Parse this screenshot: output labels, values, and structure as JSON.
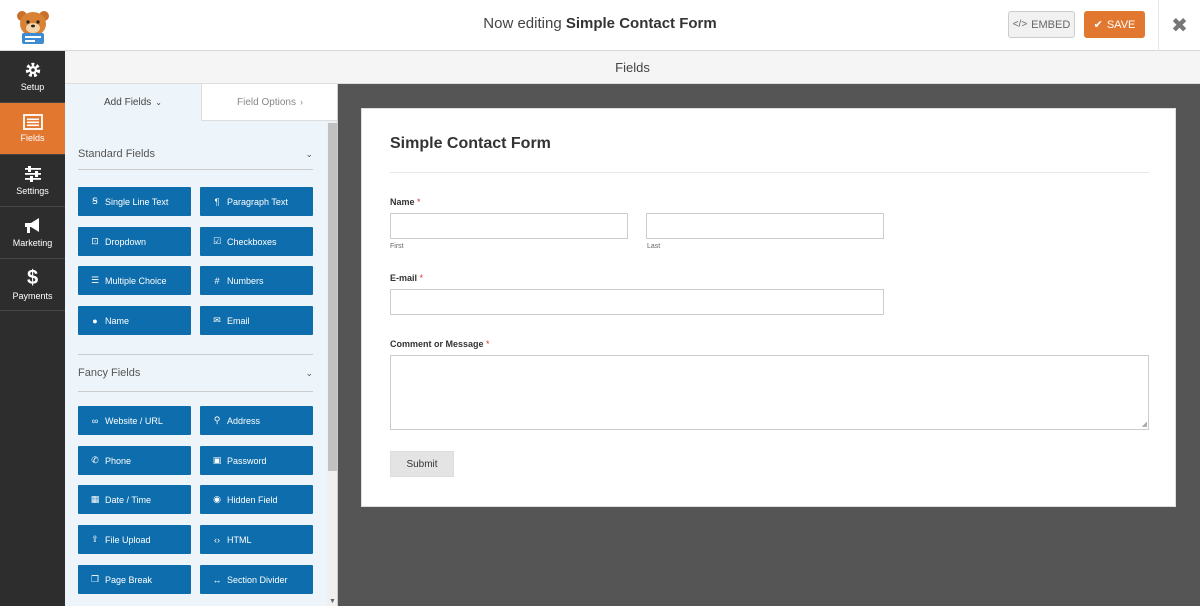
{
  "header": {
    "title_prefix": "Now editing",
    "title_form": "Simple Contact Form",
    "embed_label": "EMBED",
    "save_label": "SAVE",
    "accent": "#e27730"
  },
  "leftnav": {
    "items": [
      {
        "label": "Setup",
        "icon": "gear-icon"
      },
      {
        "label": "Fields",
        "icon": "fields-icon",
        "active": true
      },
      {
        "label": "Settings",
        "icon": "sliders-icon"
      },
      {
        "label": "Marketing",
        "icon": "megaphone-icon"
      },
      {
        "label": "Payments",
        "icon": "dollar-icon"
      }
    ]
  },
  "fieldsbar": {
    "title": "Fields"
  },
  "panel": {
    "tabs": {
      "add_fields": "Add Fields",
      "field_options": "Field Options"
    },
    "standard": {
      "title": "Standard Fields",
      "buttons": [
        {
          "label": "Single Line Text",
          "icon": "text-icon"
        },
        {
          "label": "Paragraph Text",
          "icon": "paragraph-icon"
        },
        {
          "label": "Dropdown",
          "icon": "dropdown-icon"
        },
        {
          "label": "Checkboxes",
          "icon": "checkbox-icon"
        },
        {
          "label": "Multiple Choice",
          "icon": "list-icon"
        },
        {
          "label": "Numbers",
          "icon": "hash-icon"
        },
        {
          "label": "Name",
          "icon": "user-icon"
        },
        {
          "label": "Email",
          "icon": "envelope-icon"
        }
      ]
    },
    "fancy": {
      "title": "Fancy Fields",
      "buttons": [
        {
          "label": "Website / URL",
          "icon": "link-icon"
        },
        {
          "label": "Address",
          "icon": "map-pin-icon"
        },
        {
          "label": "Phone",
          "icon": "phone-icon"
        },
        {
          "label": "Password",
          "icon": "lock-icon"
        },
        {
          "label": "Date / Time",
          "icon": "calendar-icon"
        },
        {
          "label": "Hidden Field",
          "icon": "eye-slash-icon"
        },
        {
          "label": "File Upload",
          "icon": "upload-icon"
        },
        {
          "label": "HTML",
          "icon": "code-icon"
        },
        {
          "label": "Page Break",
          "icon": "copy-icon"
        },
        {
          "label": "Section Divider",
          "icon": "arrows-h-icon"
        }
      ]
    },
    "button_color": "#0e6ead"
  },
  "preview": {
    "form_title": "Simple Contact Form",
    "name_label": "Name",
    "first_label": "First",
    "last_label": "Last",
    "email_label": "E-mail",
    "comment_label": "Comment or Message",
    "required_mark": "*",
    "submit_label": "Submit"
  }
}
